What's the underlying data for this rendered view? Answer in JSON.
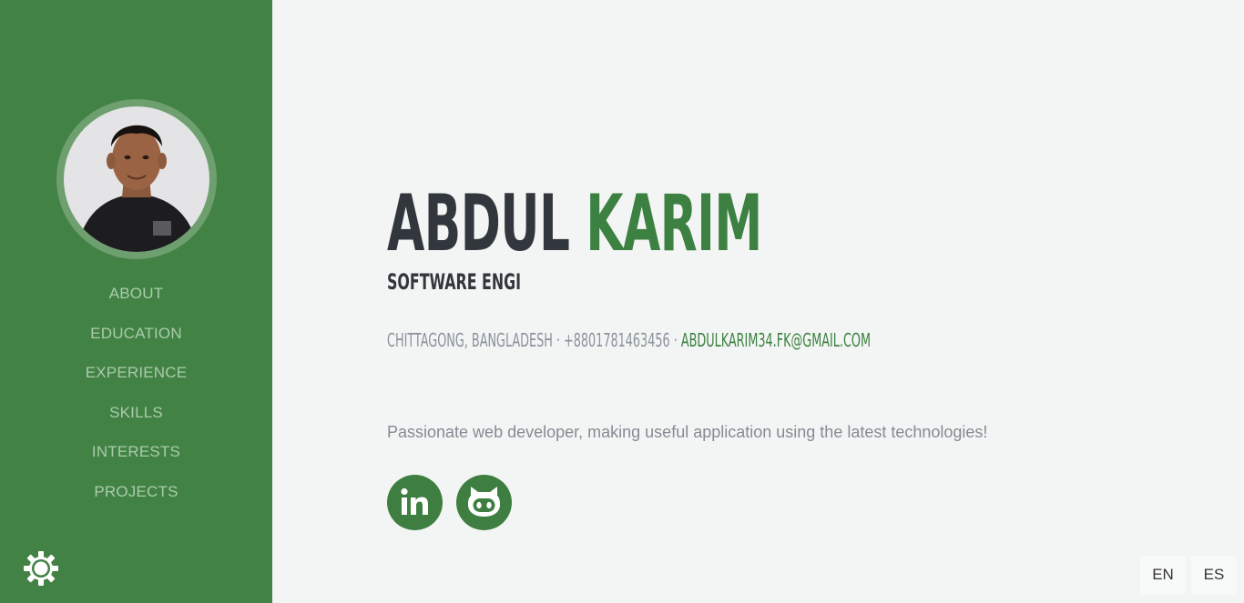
{
  "profile": {
    "first_name": "ABDUL",
    "last_name": "KARIM",
    "title": "SOFTWARE ENGI",
    "location": "CHITTAGONG, BANGLADESH",
    "separator": "·",
    "phone": "+8801781463456",
    "email": "ABDULKARIM34.FK@GMAIL.COM",
    "tagline": "Passionate web developer, making useful application using the latest technologies!"
  },
  "sidebar": {
    "nav": [
      {
        "label": "ABOUT"
      },
      {
        "label": "EDUCATION"
      },
      {
        "label": "EXPERIENCE"
      },
      {
        "label": "SKILLS"
      },
      {
        "label": "INTERESTS"
      },
      {
        "label": "PROJECTS"
      }
    ],
    "theme_toggle_icon": "gear-icon"
  },
  "social": [
    {
      "icon": "linkedin-icon"
    },
    {
      "icon": "github-icon"
    }
  ],
  "languages": {
    "en": "EN",
    "es": "ES"
  },
  "colors": {
    "sidebar_bg": "#438245",
    "accent": "#3c8141",
    "page_bg": "#f3f5f4",
    "heading": "#32373d",
    "muted": "#8a929b"
  }
}
